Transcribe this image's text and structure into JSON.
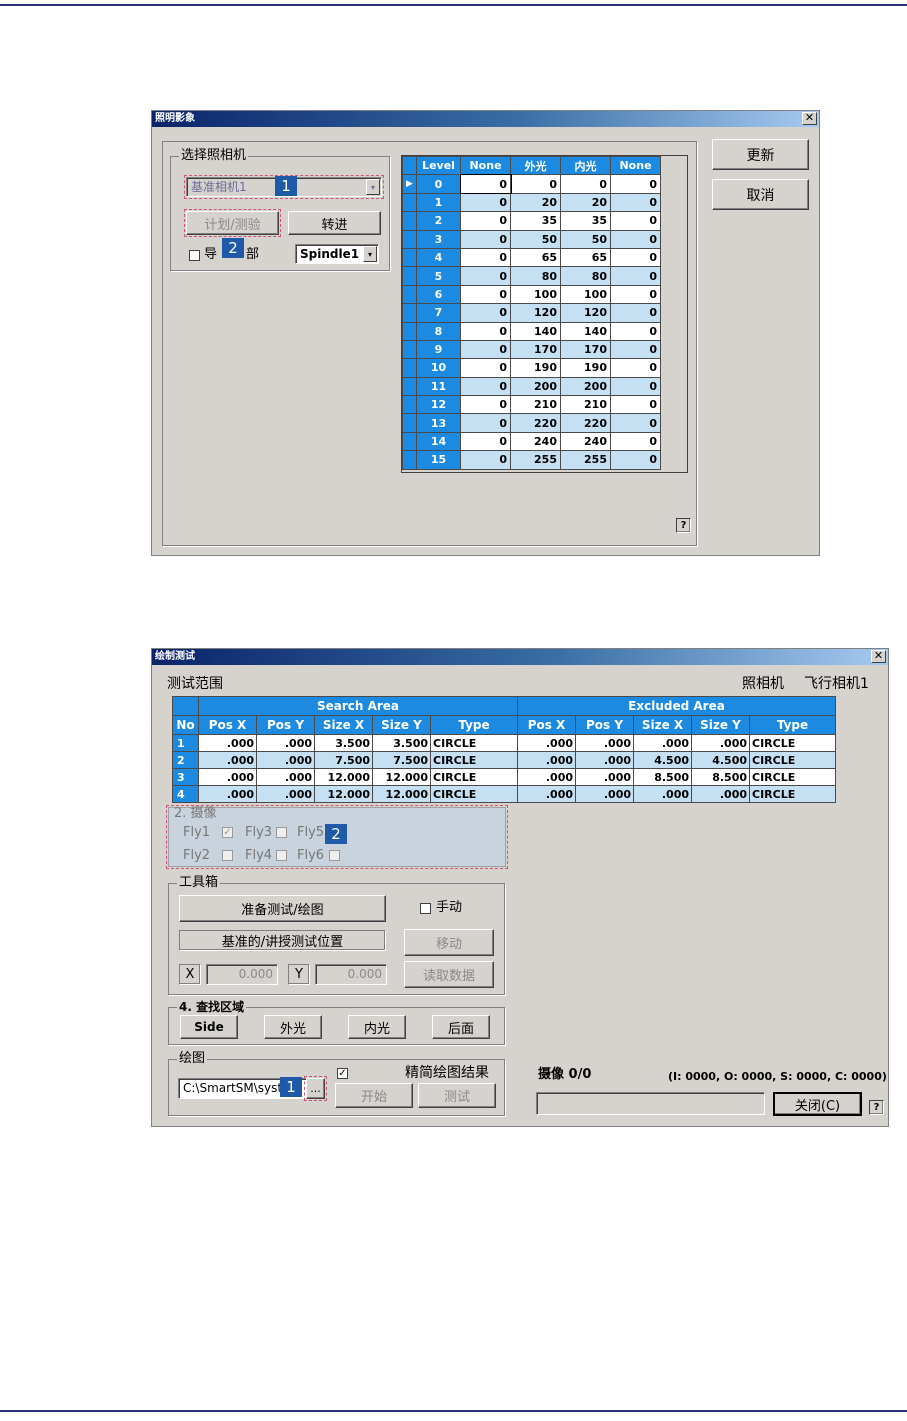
{
  "dialog1": {
    "title": "照明影象",
    "close_glyph": "✕",
    "group_camera": "选择照相机",
    "camera_select": "基准相机1",
    "plan_button": "计划/测验",
    "advance_button": "转进",
    "import_checkbox_pre": "导",
    "import_checkbox_post": "部",
    "spindle_select": "Spindle1",
    "update_button": "更新",
    "cancel_button": "取消",
    "help": "?",
    "table": {
      "headers": [
        "Level",
        "None",
        "外光",
        "内光",
        "None"
      ],
      "rows": [
        [
          "0",
          "0",
          "0",
          "0",
          "0"
        ],
        [
          "1",
          "0",
          "20",
          "20",
          "0"
        ],
        [
          "2",
          "0",
          "35",
          "35",
          "0"
        ],
        [
          "3",
          "0",
          "50",
          "50",
          "0"
        ],
        [
          "4",
          "0",
          "65",
          "65",
          "0"
        ],
        [
          "5",
          "0",
          "80",
          "80",
          "0"
        ],
        [
          "6",
          "0",
          "100",
          "100",
          "0"
        ],
        [
          "7",
          "0",
          "120",
          "120",
          "0"
        ],
        [
          "8",
          "0",
          "140",
          "140",
          "0"
        ],
        [
          "9",
          "0",
          "170",
          "170",
          "0"
        ],
        [
          "10",
          "0",
          "190",
          "190",
          "0"
        ],
        [
          "11",
          "0",
          "200",
          "200",
          "0"
        ],
        [
          "12",
          "0",
          "210",
          "210",
          "0"
        ],
        [
          "13",
          "0",
          "220",
          "220",
          "0"
        ],
        [
          "14",
          "0",
          "240",
          "240",
          "0"
        ],
        [
          "15",
          "0",
          "255",
          "255",
          "0"
        ]
      ]
    },
    "badges": [
      "1",
      "2"
    ]
  },
  "dialog2": {
    "title": "绘制测试",
    "close_glyph": "✕",
    "range_label": "测试范围",
    "camera_label": "照相机",
    "camera_value": "飞行相机1",
    "table": {
      "group_search": "Search Area",
      "group_excluded": "Excluded Area",
      "headers": [
        "No",
        "Pos X",
        "Pos Y",
        "Size X",
        "Size Y",
        "Type",
        "Pos X",
        "Pos Y",
        "Size X",
        "Size Y",
        "Type"
      ],
      "rows": [
        [
          "1",
          ".000",
          ".000",
          "3.500",
          "3.500",
          "CIRCLE",
          ".000",
          ".000",
          ".000",
          ".000",
          "CIRCLE"
        ],
        [
          "2",
          ".000",
          ".000",
          "7.500",
          "7.500",
          "CIRCLE",
          ".000",
          ".000",
          "4.500",
          "4.500",
          "CIRCLE"
        ],
        [
          "3",
          ".000",
          ".000",
          "12.000",
          "12.000",
          "CIRCLE",
          ".000",
          ".000",
          "8.500",
          "8.500",
          "CIRCLE"
        ],
        [
          "4",
          ".000",
          ".000",
          "12.000",
          "12.000",
          "CIRCLE",
          ".000",
          ".000",
          ".000",
          ".000",
          "CIRCLE"
        ]
      ]
    },
    "capture": {
      "title": "2. 摄像",
      "fly1": "Fly1",
      "fly2": "Fly2",
      "fly3": "Fly3",
      "fly4": "Fly4",
      "fly5": "Fly5",
      "fly6": "Fly6",
      "check_mark": "✓"
    },
    "toolbox": {
      "title": "工具箱",
      "prepare_button": "准备测试/绘图",
      "manual_checkbox": "手动",
      "position_button": "基准的/讲授测试位置",
      "move_button": "移动",
      "x_label": "X",
      "x_value": "0.000",
      "y_label": "Y",
      "y_value": "0.000",
      "read_button": "读取数据"
    },
    "find_area": {
      "title": "4. 查找区域",
      "side_button": "Side",
      "outer_button": "外光",
      "inner_button": "内光",
      "back_button": "后面"
    },
    "plot": {
      "title": "绘图",
      "path_value": "C:\\SmartSM\\syst",
      "browse_button": "...",
      "simplify_checkbox": "精简绘图结果",
      "start_button": "开始",
      "test_button": "测试"
    },
    "status": {
      "capture_label": "摄像 0/0",
      "counts": "(I: 0000, O: 0000, S: 0000, C: 0000)"
    },
    "close_button": "关闭(C)",
    "help": "?",
    "badges": [
      "1",
      "2"
    ]
  }
}
